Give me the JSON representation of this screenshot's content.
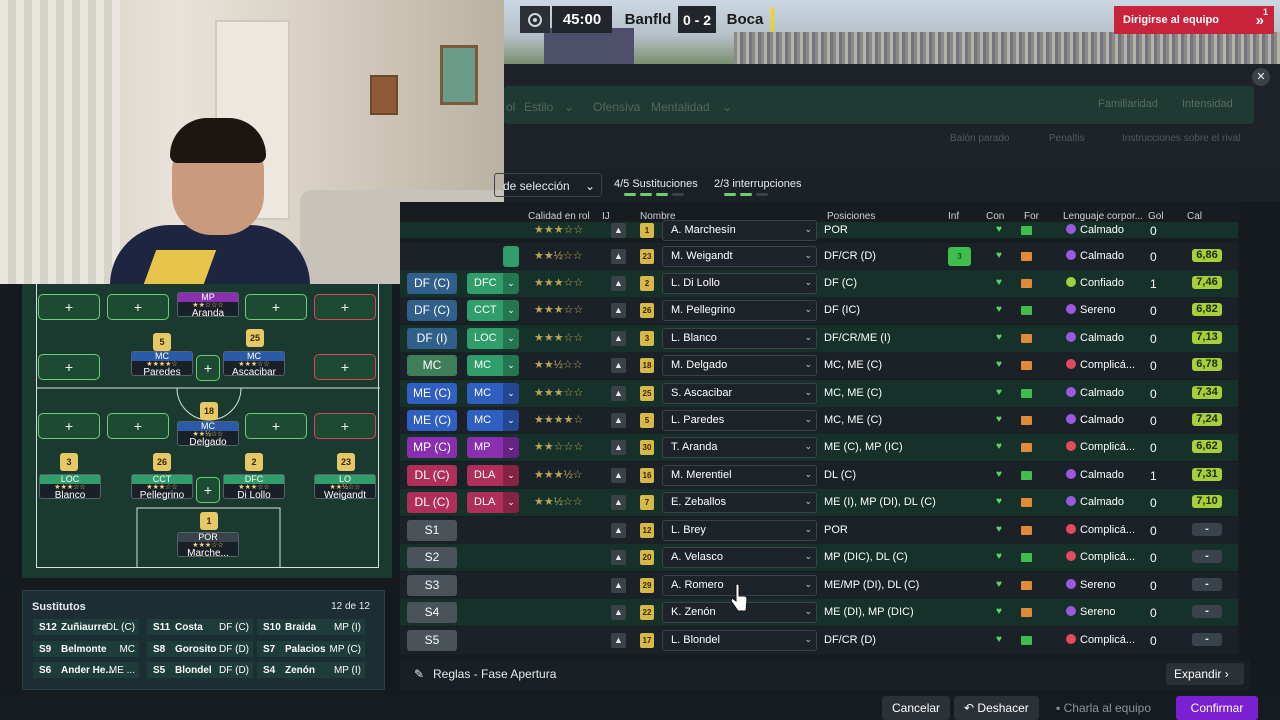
{
  "scoreboard": {
    "time": "45:00",
    "home": "Banfld",
    "score": "0 - 2",
    "away": "Boca"
  },
  "go_to_team": {
    "label": "Dirigirse al equipo",
    "count": "1"
  },
  "top_panel": {
    "filters_left": [
      "ol",
      "Estilo",
      "Ofensiva",
      "Mentalidad"
    ],
    "filters_right": [
      "Familiaridad",
      "Intensidad"
    ],
    "sub_links": [
      "Balón parado",
      "Penaltis",
      "Instrucciones sobre el rival"
    ]
  },
  "selection": {
    "mode": "de selección",
    "subs": "4/5 Sustituciones",
    "interruptions": "2/3 interrupciones"
  },
  "headers": {
    "role": "Calidad en rol",
    "ij": "IJ",
    "name": "Nombre",
    "positions": "Posiciones",
    "inf": "Inf",
    "con": "Con",
    "for": "For",
    "lang": "Lenguaje corpor...",
    "gol": "Gol",
    "cal": "Cal"
  },
  "rows": [
    {
      "role": "",
      "duty": "",
      "stars": "★★★☆☆",
      "num": "1",
      "name": "A. Marchesín",
      "pos": "POR",
      "lang": "Calmado",
      "lc": "#9b59e0",
      "gol": "0",
      "cal": "",
      "rc": "",
      "dc": "",
      "partial": true
    },
    {
      "role": "",
      "duty": "",
      "stars": "★★½☆☆",
      "num": "23",
      "name": "M. Weigandt",
      "pos": "DF/CR (D)",
      "lang": "Calmado",
      "lc": "#9b59e0",
      "gol": "0",
      "cal": "6,86",
      "inj": "3",
      "rc": "#2f9e6a",
      "dc": "#2f9e6a"
    },
    {
      "role": "DF (C)",
      "duty": "DFC",
      "stars": "★★★☆☆",
      "num": "2",
      "name": "L. Di Lollo",
      "pos": "DF (C)",
      "lang": "Confiado",
      "lc": "#9bd13a",
      "gol": "1",
      "cal": "7,46",
      "rc": "#2f5f8a",
      "dc": "#2f9e6a"
    },
    {
      "role": "DF (C)",
      "duty": "CCT",
      "stars": "★★★☆☆",
      "num": "26",
      "name": "M. Pellegrino",
      "pos": "DF (IC)",
      "lang": "Sereno",
      "lc": "#9b59e0",
      "gol": "0",
      "cal": "6,82",
      "rc": "#2f5f8a",
      "dc": "#2f9e6a"
    },
    {
      "role": "DF (I)",
      "duty": "LOC",
      "stars": "★★★☆☆",
      "num": "3",
      "name": "L. Blanco",
      "pos": "DF/CR/ME (I)",
      "lang": "Calmado",
      "lc": "#9b59e0",
      "gol": "0",
      "cal": "7,13",
      "rc": "#2f5f8a",
      "dc": "#2f9e6a"
    },
    {
      "role": "MC",
      "duty": "MC",
      "stars": "★★½☆☆",
      "num": "18",
      "name": "M. Delgado",
      "pos": "MC, ME (C)",
      "lang": "Complicá...",
      "lc": "#e5485f",
      "gol": "0",
      "cal": "6,78",
      "rc": "#3e7f5a",
      "dc": "#2f9e6a"
    },
    {
      "role": "ME (C)",
      "duty": "MC",
      "stars": "★★★☆☆",
      "num": "25",
      "name": "S. Ascacibar",
      "pos": "MC, ME (C)",
      "lang": "Calmado",
      "lc": "#9b59e0",
      "gol": "0",
      "cal": "7,34",
      "rc": "#2f5fc0",
      "dc": "#2f5fc0"
    },
    {
      "role": "ME (C)",
      "duty": "MC",
      "stars": "★★★★☆",
      "num": "5",
      "name": "L. Paredes",
      "pos": "MC, ME (C)",
      "lang": "Calmado",
      "lc": "#9b59e0",
      "gol": "0",
      "cal": "7,24",
      "rc": "#2f5fc0",
      "dc": "#2f5fc0"
    },
    {
      "role": "MP (C)",
      "duty": "MP",
      "stars": "★★☆☆☆",
      "num": "30",
      "name": "T. Aranda",
      "pos": "ME (C), MP (IC)",
      "lang": "Complicá...",
      "lc": "#e5485f",
      "gol": "0",
      "cal": "6,62",
      "rc": "#8a2fb0",
      "dc": "#8a2fb0"
    },
    {
      "role": "DL (C)",
      "duty": "DLA",
      "stars": "★★★½☆",
      "num": "16",
      "name": "M. Merentiel",
      "pos": "DL (C)",
      "lang": "Calmado",
      "lc": "#9b59e0",
      "gol": "1",
      "cal": "7,31",
      "rc": "#b02f5a",
      "dc": "#b02f5a"
    },
    {
      "role": "DL (C)",
      "duty": "DLA",
      "stars": "★★½☆☆",
      "num": "7",
      "name": "E. Zeballos",
      "pos": "ME (I), MP (DI), DL (C)",
      "lang": "Calmado",
      "lc": "#9b59e0",
      "gol": "0",
      "cal": "7,10",
      "rc": "#b02f5a",
      "dc": "#b02f5a"
    },
    {
      "role": "S1",
      "duty": "",
      "stars": "",
      "num": "12",
      "name": "L. Brey",
      "pos": "POR",
      "lang": "Complicá...",
      "lc": "#e5485f",
      "gol": "0",
      "cal": "-",
      "rc": "#4a535a",
      "dc": ""
    },
    {
      "role": "S2",
      "duty": "",
      "stars": "",
      "num": "20",
      "name": "A. Velasco",
      "pos": "MP (DIC), DL (C)",
      "lang": "Complicá...",
      "lc": "#e5485f",
      "gol": "0",
      "cal": "-",
      "rc": "#4a535a",
      "dc": ""
    },
    {
      "role": "S3",
      "duty": "",
      "stars": "",
      "num": "29",
      "name": "A. Romero",
      "pos": "ME/MP (DI), DL (C)",
      "lang": "Sereno",
      "lc": "#9b59e0",
      "gol": "0",
      "cal": "-",
      "rc": "#4a535a",
      "dc": ""
    },
    {
      "role": "S4",
      "duty": "",
      "stars": "",
      "num": "22",
      "name": "K. Zenón",
      "pos": "ME (DI), MP (DIC)",
      "lang": "Sereno",
      "lc": "#9b59e0",
      "gol": "0",
      "cal": "-",
      "rc": "#4a535a",
      "dc": ""
    },
    {
      "role": "S5",
      "duty": "",
      "stars": "",
      "num": "17",
      "name": "L. Blondel",
      "pos": "DF/CR (D)",
      "lang": "Complicá...",
      "lc": "#e5485f",
      "gol": "0",
      "cal": "-",
      "rc": "#4a535a",
      "dc": ""
    }
  ],
  "pitch": {
    "players": [
      {
        "role": "MP",
        "name": "Aranda",
        "num": "",
        "stars": "★★☆☆☆"
      },
      {
        "role": "MC",
        "name": "Paredes",
        "num": "5",
        "stars": "★★★★☆"
      },
      {
        "role": "MC",
        "name": "Ascacibar",
        "num": "25",
        "stars": "★★★☆☆"
      },
      {
        "role": "MC",
        "name": "Delgado",
        "num": "18",
        "stars": "★★½☆☆"
      },
      {
        "role": "LOC",
        "name": "Blanco",
        "num": "3",
        "stars": "★★★☆☆"
      },
      {
        "role": "CCT",
        "name": "Pellegrino",
        "num": "26",
        "stars": "★★★☆☆"
      },
      {
        "role": "DFC",
        "name": "Di Lollo",
        "num": "2",
        "stars": "★★★☆☆"
      },
      {
        "role": "LO",
        "name": "Weigandt",
        "num": "23",
        "stars": "★★½☆☆"
      },
      {
        "role": "POR",
        "name": "Marche...",
        "num": "1",
        "stars": "★★★☆☆"
      }
    ],
    "plus": "+"
  },
  "substitutes": {
    "title": "Sustitutos",
    "count": "12 de 12",
    "items": [
      {
        "num": "S12",
        "name": "Zuñiaurre",
        "pos": "DL (C)"
      },
      {
        "num": "S11",
        "name": "Costa",
        "pos": "DF (C)"
      },
      {
        "num": "S10",
        "name": "Braida",
        "pos": "MP (I)"
      },
      {
        "num": "S9",
        "name": "Belmonte",
        "pos": "MC"
      },
      {
        "num": "S8",
        "name": "Gorosito",
        "pos": "DF (D)"
      },
      {
        "num": "S7",
        "name": "Palacios",
        "pos": "MP (C)"
      },
      {
        "num": "S6",
        "name": "Ander He...",
        "pos": "ME ..."
      },
      {
        "num": "S5",
        "name": "Blondel",
        "pos": "DF (D)"
      },
      {
        "num": "S4",
        "name": "Zenón",
        "pos": "MP (I)"
      }
    ]
  },
  "rules": {
    "label": "Reglas - Fase Apertura",
    "expand": "Expandir"
  },
  "footer": {
    "cancel": "Cancelar",
    "undo": "Deshacer",
    "team_talk": "Charla al equipo",
    "confirm": "Confirmar"
  },
  "colors": {
    "accent": "#7a1fd1",
    "danger": "#c8233a",
    "green": "#3fbe4e"
  }
}
